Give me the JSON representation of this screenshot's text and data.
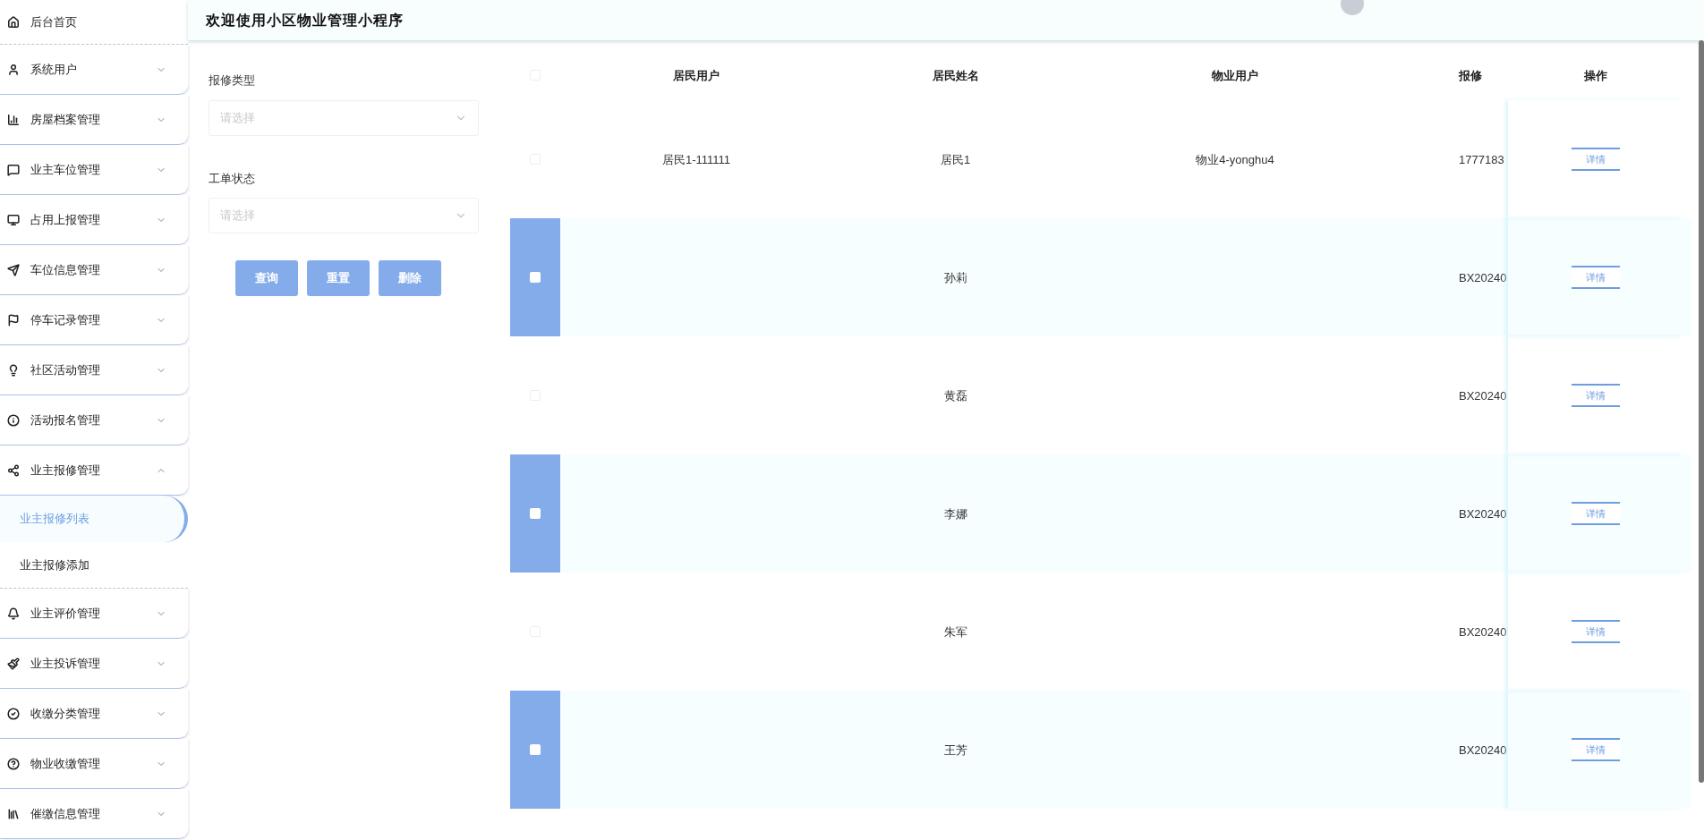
{
  "header": {
    "title": "欢迎使用小区物业管理小程序"
  },
  "sidebar": {
    "items": [
      {
        "label": "后台首页"
      },
      {
        "label": "系统用户",
        "expandable": true,
        "expanded": false
      },
      {
        "label": "房屋档案管理",
        "expandable": true,
        "expanded": false
      },
      {
        "label": "业主车位管理",
        "expandable": true,
        "expanded": false
      },
      {
        "label": "占用上报管理",
        "expandable": true,
        "expanded": false
      },
      {
        "label": "车位信息管理",
        "expandable": true,
        "expanded": false
      },
      {
        "label": "停车记录管理",
        "expandable": true,
        "expanded": false
      },
      {
        "label": "社区活动管理",
        "expandable": true,
        "expanded": false
      },
      {
        "label": "活动报名管理",
        "expandable": true,
        "expanded": false
      },
      {
        "label": "业主报修管理",
        "expandable": true,
        "expanded": true,
        "children": [
          {
            "label": "业主报修列表",
            "selected": true
          },
          {
            "label": "业主报修添加",
            "selected": false
          }
        ]
      },
      {
        "label": "业主评价管理",
        "expandable": true,
        "expanded": false
      },
      {
        "label": "业主投诉管理",
        "expandable": true,
        "expanded": false
      },
      {
        "label": "收缴分类管理",
        "expandable": true,
        "expanded": false
      },
      {
        "label": "物业收缴管理",
        "expandable": true,
        "expanded": false
      },
      {
        "label": "催缴信息管理",
        "expandable": true,
        "expanded": false
      }
    ]
  },
  "filters": [
    {
      "label": "报修类型",
      "placeholder": "请选择"
    },
    {
      "label": "工单状态",
      "placeholder": "请选择"
    }
  ],
  "actions": [
    "查询",
    "重置",
    "删除"
  ],
  "table": {
    "columns": [
      "居民用户",
      "居民姓名",
      "物业用户",
      "报修",
      "操作"
    ],
    "all_selected": false,
    "rows": [
      {
        "selected": false,
        "cells": [
          "居民1-111111",
          "居民1",
          "物业4-yonghu4",
          "1777183"
        ],
        "action": "详情"
      },
      {
        "selected": true,
        "cells": [
          "",
          "孙莉",
          "",
          "BX20240"
        ],
        "action": "详情"
      },
      {
        "selected": false,
        "cells": [
          "",
          "黄磊",
          "",
          "BX20240"
        ],
        "action": "详情"
      },
      {
        "selected": true,
        "cells": [
          "",
          "李娜",
          "",
          "BX20240"
        ],
        "action": "详情"
      },
      {
        "selected": false,
        "cells": [
          "",
          "朱军",
          "",
          "BX20240"
        ],
        "action": "详情"
      },
      {
        "selected": true,
        "cells": [
          "",
          "王芳",
          "",
          "BX20240"
        ],
        "action": "详情"
      }
    ]
  }
}
